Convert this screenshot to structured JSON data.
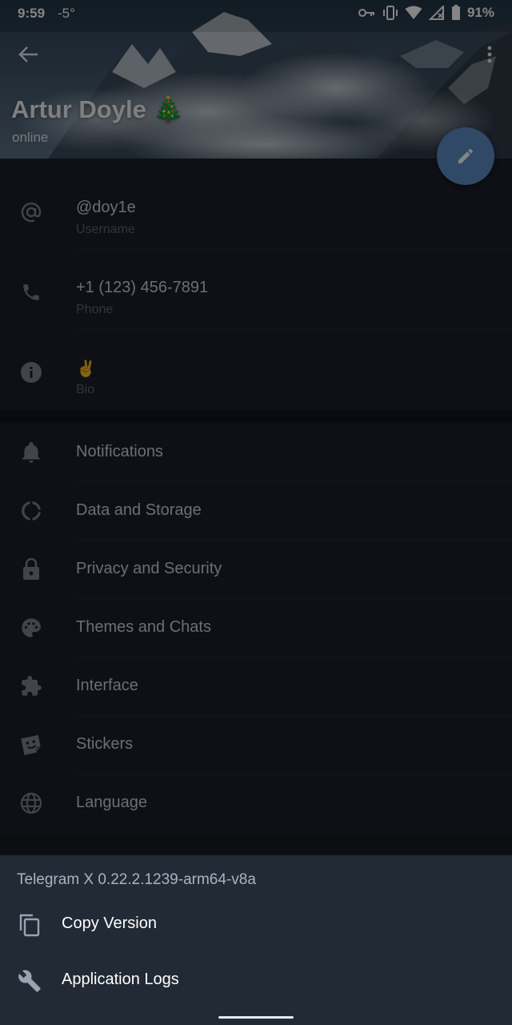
{
  "status_bar": {
    "time": "9:59",
    "temperature": "-5°",
    "battery": "91%"
  },
  "profile": {
    "name": "Artur Doyle 🎄",
    "status": "online"
  },
  "info": [
    {
      "icon": "at-icon",
      "value": "@doy1e",
      "label": "Username"
    },
    {
      "icon": "phone-icon",
      "value": "+1 (123) 456-7891",
      "label": "Phone"
    },
    {
      "icon": "info-icon",
      "value": "✌️",
      "label": "Bio"
    }
  ],
  "settings": [
    {
      "icon": "bell-icon",
      "label": "Notifications"
    },
    {
      "icon": "data-storage-icon",
      "label": "Data and Storage"
    },
    {
      "icon": "lock-icon",
      "label": "Privacy and Security"
    },
    {
      "icon": "palette-icon",
      "label": "Themes and Chats"
    },
    {
      "icon": "puzzle-icon",
      "label": "Interface"
    },
    {
      "icon": "sticker-icon",
      "label": "Stickers"
    },
    {
      "icon": "globe-icon",
      "label": "Language"
    }
  ],
  "sheet": {
    "version": "Telegram X 0.22.2.1239-arm64-v8a",
    "items": [
      {
        "icon": "copy-icon",
        "label": "Copy Version"
      },
      {
        "icon": "wrench-icon",
        "label": "Application Logs"
      }
    ]
  },
  "colors": {
    "accent": "#5b8dc4",
    "background": "#1b2029",
    "sheet": "#222a36"
  }
}
